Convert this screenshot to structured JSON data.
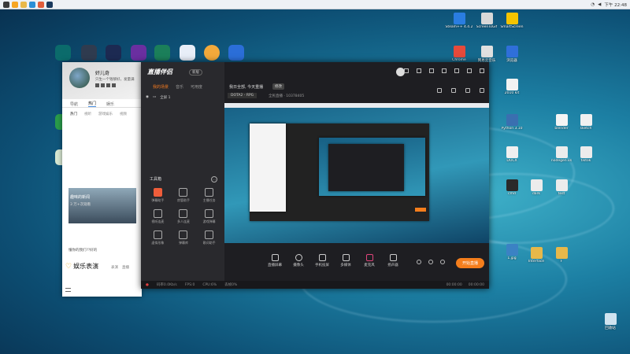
{
  "taskbar": {
    "time": "下午 22:48"
  },
  "desktop_icons_right": [
    {
      "label": "Steam++ 4.4.2",
      "color": "#2a7de1"
    },
    {
      "label": "ScreenToGif",
      "color": "#d8d8d8"
    },
    {
      "label": "SmartScreen",
      "color": "#f5c400"
    },
    {
      "label": "Chrome",
      "color": "#e64a3b"
    },
    {
      "label": "网易云音乐",
      "color": "#e0e0e0"
    },
    {
      "label": "浏览器",
      "color": "#2f6fd9"
    },
    {
      "label": "2010 kit",
      "color": "#f2f2f2"
    },
    {
      "label": "Python 3.10",
      "color": "#3a6fb0"
    },
    {
      "label": "blender",
      "color": "#f4f4f4"
    },
    {
      "label": "sketch",
      "color": "#f0f0f0"
    },
    {
      "label": "DOCX",
      "color": "#f0f0f0"
    },
    {
      "label": "nodegen.vs",
      "color": "#ececec"
    },
    {
      "label": "tiktok",
      "color": "#ececec"
    },
    {
      "label": "cmd",
      "color": "#2a2a2a"
    },
    {
      "label": "dark",
      "color": "#ececec"
    },
    {
      "label": "test",
      "color": "#ececec"
    },
    {
      "label": "1.jpg",
      "color": "#3b82c4"
    },
    {
      "label": "Interface",
      "color": "#e6b84a"
    },
    {
      "label": "F",
      "color": "#e6b84a"
    },
    {
      "label": "回收站",
      "color": "#cfe3f0"
    }
  ],
  "qq": {
    "nickname": "奸儿奇",
    "signature": "只生一个钱够好，发量满",
    "tabs": [
      "导航",
      "热门",
      "娱乐"
    ],
    "subtabs": [
      "热门",
      "视听",
      "游戏娱乐",
      "视频"
    ],
    "banner_title": "趣味的新闻",
    "banner_meta": "3 万+次观看",
    "caption": "懂你的我们??好的",
    "section_title": "娱乐表演",
    "section_links": [
      "表演",
      "直播"
    ]
  },
  "streamer": {
    "brand": "直播伴侣",
    "version_badge": "新版",
    "left_tabs": [
      "我的场景",
      "音乐",
      "可用度"
    ],
    "scene_name": "全屏 1",
    "tools_title": "工具箱",
    "tools": [
      "弹幕助手",
      "房管助手",
      "主播任务",
      "视听连麦",
      "多人连麦",
      "游戏弹幕",
      "虚拟形象",
      "弹幕库",
      "歌词助手",
      "PK对战",
      "下载管理",
      "其他"
    ],
    "stream_title": "我日全部, 今天重播",
    "edit_label": "修改",
    "game_tag": "DOTA2 - RPG",
    "room_info": "全民直播 · 10378405",
    "controls": [
      "直播屏幕",
      "摄像头",
      "手机投屏",
      "多媒体",
      "麦克风",
      "扬声器"
    ],
    "start_button": "开始直播",
    "status": {
      "bitrate": "码率0.0Kb/s",
      "fps": "FPS:0",
      "cpu": "CPU:6%",
      "dropped": "丢帧0%",
      "duration": "00:00:00",
      "live_time": "00:00:00"
    }
  }
}
